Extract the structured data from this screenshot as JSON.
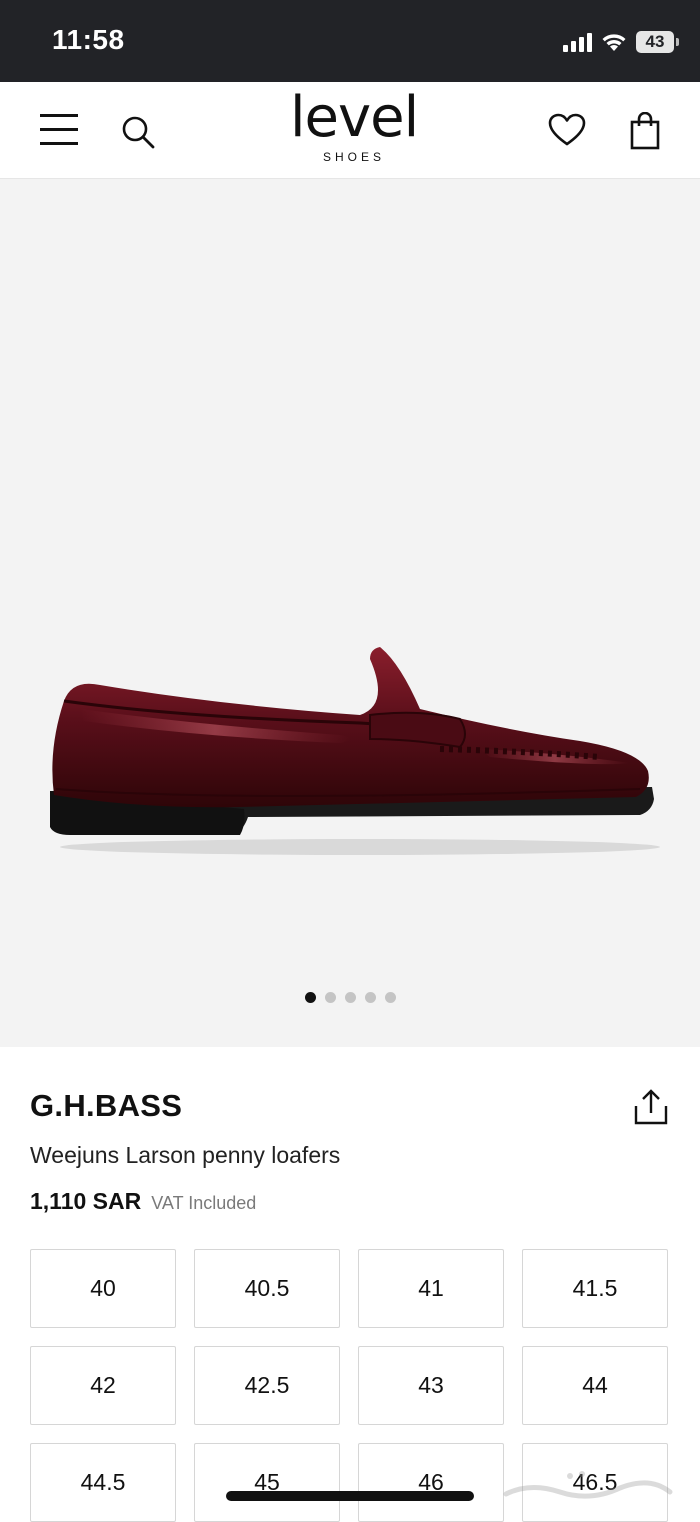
{
  "status_bar": {
    "time": "11:58",
    "battery": "43"
  },
  "header": {
    "logo_main": "level",
    "logo_sub": "SHOES",
    "icons": [
      "menu-icon",
      "search-icon",
      "heart-icon",
      "shopping-bag-icon"
    ]
  },
  "gallery": {
    "image_subject": "burgundy penny loafer",
    "total_images": 5,
    "active_index": 0
  },
  "product": {
    "brand": "G.H.BASS",
    "name": "Weejuns Larson penny loafers",
    "price": "1,110 SAR",
    "vat_note": "VAT Included"
  },
  "sizes": [
    "40",
    "40.5",
    "41",
    "41.5",
    "42",
    "42.5",
    "43",
    "44",
    "44.5",
    "45",
    "46",
    "46.5"
  ],
  "colors": {
    "status_bar_bg": "#222327",
    "image_bg": "#f3f3f3",
    "text": "#111111",
    "muted": "#7a7a7a",
    "border": "#d6d6d6"
  }
}
